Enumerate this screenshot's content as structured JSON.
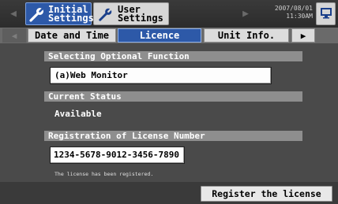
{
  "topbar": {
    "initial_settings_line1": "Initial",
    "initial_settings_line2": "Settings",
    "user_settings_line1": "User",
    "user_settings_line2": "Settings",
    "date": "2007/08/01",
    "time": "11:30AM"
  },
  "tabs": {
    "date_and_time": "Date and Time",
    "licence": "Licence",
    "unit_info": "Unit Info.",
    "active": "Licence"
  },
  "sections": {
    "optional_function_header": "Selecting Optional Function",
    "optional_function_value": "(a)Web Monitor",
    "current_status_header": "Current Status",
    "current_status_value": "Available",
    "registration_header": "Registration of License Number",
    "license_number": "1234-5678-9012-3456-7890",
    "registered_message": "The license has been registered."
  },
  "actions": {
    "register_label": "Register the license"
  },
  "colors": {
    "background": "#4a4a4a",
    "accent_blue": "#2d59a8",
    "section_header": "#8e8e8e"
  },
  "icons": {
    "initial": "wrench-icon",
    "user": "wrench-icon",
    "monitor": "monitor-icon"
  }
}
